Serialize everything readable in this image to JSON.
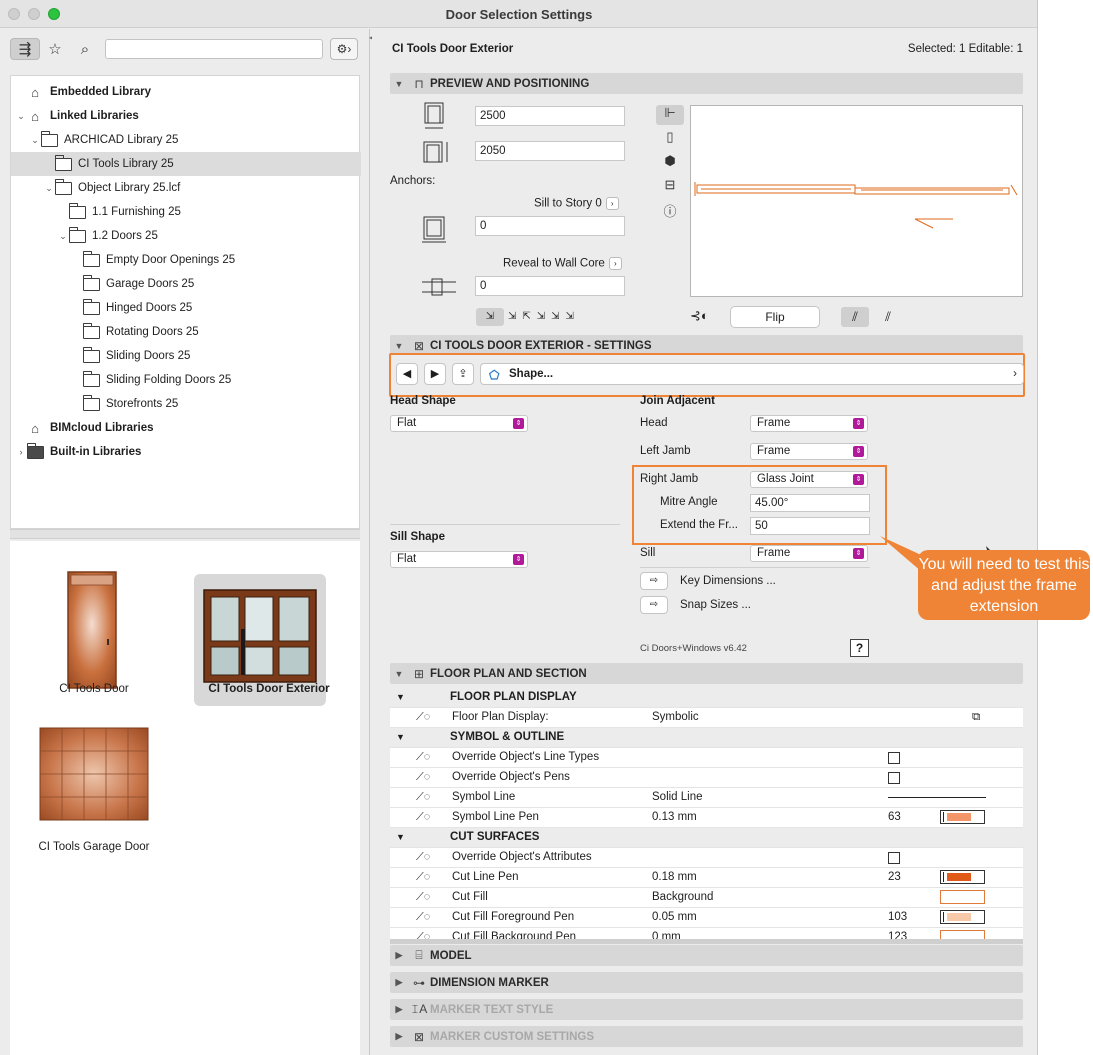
{
  "window": {
    "title": "Door Selection Settings"
  },
  "left": {
    "tree": [
      {
        "label": "Embedded Library",
        "bold": true,
        "indent": 0,
        "icon": "library-icon",
        "expanded": null
      },
      {
        "label": "Linked Libraries",
        "bold": true,
        "indent": 0,
        "icon": "library-icon",
        "expanded": true
      },
      {
        "label": "ARCHICAD Library 25",
        "bold": false,
        "indent": 1,
        "icon": "folder-icon",
        "expanded": true
      },
      {
        "label": "CI Tools Library 25",
        "bold": false,
        "indent": 2,
        "icon": "folder-icon",
        "expanded": null,
        "selected": true
      },
      {
        "label": "Object Library 25.lcf",
        "bold": false,
        "indent": 2,
        "icon": "folder-icon",
        "expanded": true
      },
      {
        "label": "1.1 Furnishing 25",
        "bold": false,
        "indent": 3,
        "icon": "folder-icon",
        "expanded": null
      },
      {
        "label": "1.2 Doors 25",
        "bold": false,
        "indent": 3,
        "icon": "folder-icon",
        "expanded": true
      },
      {
        "label": "Empty Door Openings 25",
        "bold": false,
        "indent": 4,
        "icon": "folder-icon",
        "expanded": null
      },
      {
        "label": "Garage Doors 25",
        "bold": false,
        "indent": 4,
        "icon": "folder-icon",
        "expanded": null
      },
      {
        "label": "Hinged Doors 25",
        "bold": false,
        "indent": 4,
        "icon": "folder-icon",
        "expanded": null
      },
      {
        "label": "Rotating Doors 25",
        "bold": false,
        "indent": 4,
        "icon": "folder-icon",
        "expanded": null
      },
      {
        "label": "Sliding Doors 25",
        "bold": false,
        "indent": 4,
        "icon": "folder-icon",
        "expanded": null
      },
      {
        "label": "Sliding Folding Doors 25",
        "bold": false,
        "indent": 4,
        "icon": "folder-icon",
        "expanded": null
      },
      {
        "label": "Storefronts 25",
        "bold": false,
        "indent": 4,
        "icon": "folder-icon",
        "expanded": null
      },
      {
        "label": "BIMcloud Libraries",
        "bold": true,
        "indent": 0,
        "icon": "library-icon",
        "expanded": null
      },
      {
        "label": "Built-in Libraries",
        "bold": true,
        "indent": 0,
        "icon": "folder-icon",
        "expanded": false
      }
    ],
    "thumbs": {
      "door": "CI Tools Door",
      "exterior": "CI Tools Door Exterior",
      "garage": "CI Tools Garage Door"
    }
  },
  "header": {
    "title": "CI Tools Door Exterior",
    "selected": "Selected: 1 Editable: 1"
  },
  "sections": {
    "preview": "PREVIEW AND POSITIONING",
    "settings": "CI TOOLS DOOR EXTERIOR - SETTINGS",
    "floorplan": "FLOOR PLAN AND SECTION",
    "model": "MODEL",
    "dimension": "DIMENSION MARKER",
    "marker_text": "MARKER TEXT STYLE",
    "marker_custom": "MARKER CUSTOM SETTINGS"
  },
  "preview": {
    "width": "2500",
    "height": "2050",
    "anchors_label": "Anchors:",
    "sill_label": "Sill to Story 0",
    "sill_value": "0",
    "reveal_label": "Reveal to Wall Core",
    "reveal_value": "0",
    "flip": "Flip"
  },
  "settings": {
    "nav_shape": "Shape...",
    "head_shape_label": "Head Shape",
    "head_shape_value": "Flat",
    "sill_shape_label": "Sill Shape",
    "sill_shape_value": "Flat",
    "join_adjacent": "Join Adjacent",
    "head_label": "Head",
    "head_value": "Frame",
    "left_jamb_label": "Left Jamb",
    "left_jamb_value": "Frame",
    "right_jamb_label": "Right Jamb",
    "right_jamb_value": "Glass Joint",
    "mitre_label": "Mitre Angle",
    "mitre_value": "45.00°",
    "extend_label": "Extend the Fr...",
    "extend_value": "50",
    "sill_label": "Sill",
    "sill_value": "Frame",
    "key_dims": "Key Dimensions ...",
    "snap_sizes": "Snap Sizes ...",
    "version": "Ci Doors+Windows v6.42",
    "help": "?"
  },
  "callout": "You will need to test this and adjust the frame extension",
  "table": {
    "rows": [
      {
        "kind": "group",
        "label": "FLOOR PLAN DISPLAY"
      },
      {
        "kind": "row",
        "label": "Floor Plan Display:",
        "value": "Symbolic",
        "num": "",
        "extra": "plan-icon"
      },
      {
        "kind": "group",
        "label": "SYMBOL & OUTLINE"
      },
      {
        "kind": "row",
        "label": "Override Object's Line Types",
        "value": "",
        "num": "",
        "extra": "checkbox"
      },
      {
        "kind": "row",
        "label": "Override Object's Pens",
        "value": "",
        "num": "",
        "extra": "checkbox"
      },
      {
        "kind": "row",
        "label": "Symbol Line",
        "value": "Solid Line",
        "num": "",
        "extra": "line"
      },
      {
        "kind": "row",
        "label": "Symbol Line Pen",
        "value": "0.13 mm",
        "num": "63",
        "extra": "swatch-light"
      },
      {
        "kind": "group",
        "label": "CUT SURFACES"
      },
      {
        "kind": "row",
        "label": "Override Object's Attributes",
        "value": "",
        "num": "",
        "extra": "checkbox"
      },
      {
        "kind": "row",
        "label": "Cut Line Pen",
        "value": "0.18 mm",
        "num": "23",
        "extra": "swatch-dark"
      },
      {
        "kind": "row",
        "label": "Cut Fill",
        "value": "Background",
        "num": "",
        "extra": "swatch-empty"
      },
      {
        "kind": "row",
        "label": "Cut Fill Foreground Pen",
        "value": "0.05 mm",
        "num": "103",
        "extra": "swatch-pale"
      },
      {
        "kind": "row",
        "label": "Cut Fill Background Pen",
        "value": "0 mm",
        "num": "123",
        "extra": "swatch-empty"
      }
    ]
  },
  "colors": {
    "accent": "#f08436",
    "popup": "#b01a99"
  }
}
